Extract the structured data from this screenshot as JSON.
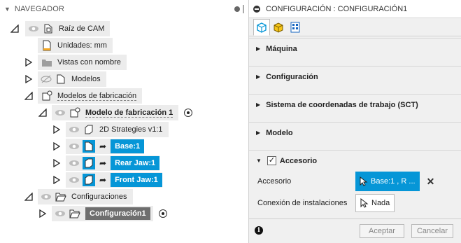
{
  "navigator": {
    "title": "NAVEGADOR",
    "rows": [
      {
        "label": "Raíz de CAM"
      },
      {
        "label": "Unidades: mm"
      },
      {
        "label": "Vistas con nombre"
      },
      {
        "label": "Modelos"
      },
      {
        "label": "Modelos de fabricación"
      },
      {
        "label": "Modelo de fabricación 1"
      },
      {
        "label": "2D Strategies v1:1"
      },
      {
        "label": "Base:1"
      },
      {
        "label": "Rear Jaw:1"
      },
      {
        "label": "Front Jaw:1"
      },
      {
        "label": "Configuraciones"
      },
      {
        "label": "Configuración1"
      }
    ]
  },
  "panel": {
    "title": "CONFIGURACIÓN : CONFIGURACIÓN1",
    "sections": [
      {
        "title": "Máquina"
      },
      {
        "title": "Configuración"
      },
      {
        "title": "Sistema de coordenadas de trabajo (SCT)"
      },
      {
        "title": "Modelo"
      },
      {
        "title": "Accesorio"
      }
    ],
    "fixture": {
      "label": "Accesorio",
      "value": "Base:1 , R ...",
      "clear": "✕"
    },
    "installation": {
      "label": "Conexión de instalaciones",
      "value": "Nada"
    },
    "ok_label": "Aceptar",
    "cancel_label": "Cancelar",
    "info": "i"
  },
  "colors": {
    "selection": "#0696d7",
    "selection_gray": "#6e6e6e"
  }
}
